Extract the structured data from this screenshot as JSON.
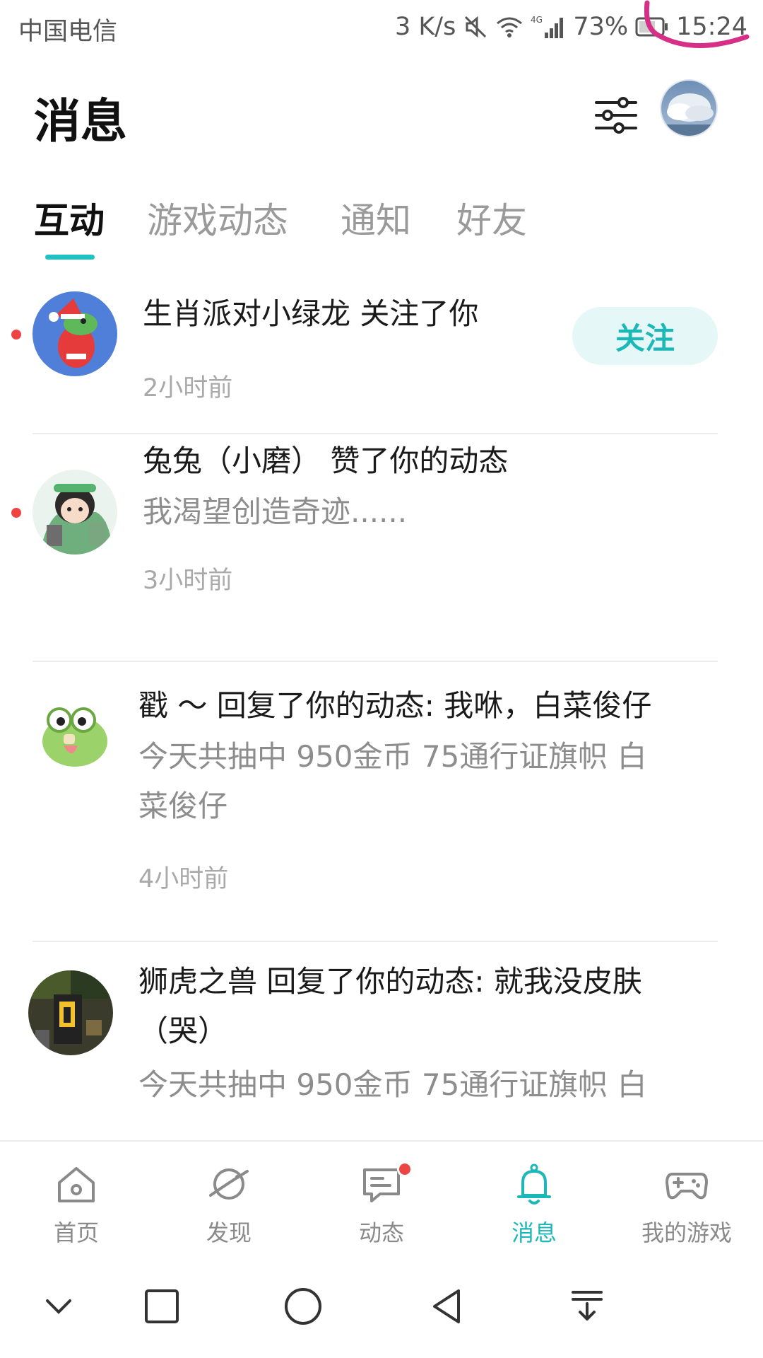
{
  "status_bar": {
    "carrier": "中国电信",
    "net_speed": "3 K/s",
    "network": "4G",
    "battery": "73%",
    "time": "15:24"
  },
  "header": {
    "title": "消息",
    "filter_icon": "sliders-icon"
  },
  "tabs": [
    {
      "label": "互动",
      "active": true
    },
    {
      "label": "游戏动态",
      "active": false
    },
    {
      "label": "通知",
      "active": false
    },
    {
      "label": "好友",
      "active": false
    }
  ],
  "messages": [
    {
      "title": "生肖派对小绿龙 关注了你",
      "time": "2小时前",
      "unread": true,
      "action_label": "关注"
    },
    {
      "title": "兔兔（小磨） 赞了你的动态",
      "subtitle": "我渴望创造奇迹......",
      "time": "3小时前",
      "unread": true
    },
    {
      "title": "戳 ～ 回复了你的动态: 我咻，白菜俊仔",
      "subtitle_line1": "今天共抽中 950金币 75通行证旗帜 白",
      "subtitle_line2": "菜俊仔",
      "time": "4小时前",
      "unread": false
    },
    {
      "title_line1": "狮虎之兽 回复了你的动态: 就我没皮肤",
      "title_line2": "（哭）",
      "subtitle_line1": "今天共抽中 950金币 75通行证旗帜 白",
      "unread": false
    }
  ],
  "bottom_nav": [
    {
      "label": "首页",
      "icon": "home-icon",
      "active": false
    },
    {
      "label": "发现",
      "icon": "planet-icon",
      "active": false
    },
    {
      "label": "动态",
      "icon": "chat-icon",
      "active": false,
      "badge": true
    },
    {
      "label": "消息",
      "icon": "bell-icon",
      "active": true
    },
    {
      "label": "我的游戏",
      "icon": "gamepad-icon",
      "active": false
    }
  ],
  "system_nav": [
    "chevron-down-icon",
    "square-icon",
    "circle-icon",
    "back-triangle-icon",
    "download-icon"
  ],
  "colors": {
    "accent": "#1cb7b7",
    "unread_dot": "#ef4444"
  }
}
